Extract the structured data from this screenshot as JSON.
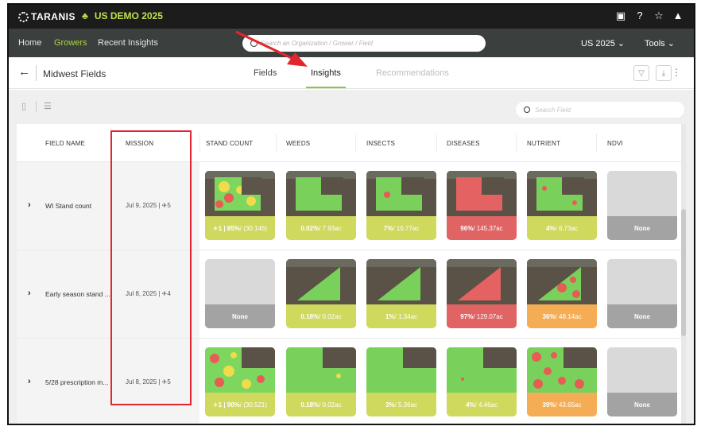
{
  "topbar": {
    "logo": "TARANIS",
    "demo_label": "US DEMO 2025"
  },
  "nav": {
    "home": "Home",
    "growers": "Growers",
    "recent": "Recent Insights",
    "search_placeholder": "Search an Organization / Grower / Field",
    "season": "US 2025",
    "tools": "Tools"
  },
  "subheader": {
    "back": "←",
    "title": "Midwest Fields",
    "tabs": [
      "Fields",
      "Insights",
      "Recommendations"
    ]
  },
  "toolbar": {
    "search_placeholder": "Search Field"
  },
  "table": {
    "headers": [
      "FIELD NAME",
      "MISSION",
      "STAND COUNT",
      "WEEDS",
      "INSECTS",
      "DISEASES",
      "NUTRIENT",
      "NDVI"
    ],
    "rows": [
      {
        "name": "WI Stand count",
        "mission": "Jul 9, 2025 | ✈5",
        "tiles": [
          {
            "strong": "✈1 | 85%",
            "rest": " / (30.146)",
            "color": "#cfd95e"
          },
          {
            "strong": "0.02%",
            "rest": " / 7.93ac",
            "color": "#cfd95e"
          },
          {
            "strong": "7%",
            "rest": " / 10.77ac",
            "color": "#cfd95e"
          },
          {
            "strong": "96%",
            "rest": " / 145.37ac",
            "color": "#e16464"
          },
          {
            "strong": "4%",
            "rest": " / 6.73ac",
            "color": "#cfd95e"
          },
          {
            "strong": "None",
            "rest": "",
            "color": "#a3a3a3"
          }
        ]
      },
      {
        "name": "Early season stand ...",
        "mission": "Jul 8, 2025 | ✈4",
        "tiles": [
          {
            "strong": "None",
            "rest": "",
            "color": "#a3a3a3"
          },
          {
            "strong": "0.18%",
            "rest": " / 0.02ac",
            "color": "#cfd95e"
          },
          {
            "strong": "1%",
            "rest": " / 1.34ac",
            "color": "#cfd95e"
          },
          {
            "strong": "97%",
            "rest": " / 129.07ac",
            "color": "#e16464"
          },
          {
            "strong": "36%",
            "rest": " / 48.14ac",
            "color": "#f5ad55"
          },
          {
            "strong": "None",
            "rest": "",
            "color": "#a3a3a3"
          }
        ]
      },
      {
        "name": "5/28 prescription m...",
        "mission": "Jul 8, 2025 | ✈5",
        "tiles": [
          {
            "strong": "✈1 | 90%",
            "rest": " / (30.521)",
            "color": "#cfd95e"
          },
          {
            "strong": "0.18%",
            "rest": " / 0.02ac",
            "color": "#cfd95e"
          },
          {
            "strong": "3%",
            "rest": " / 5.36ac",
            "color": "#cfd95e"
          },
          {
            "strong": "4%",
            "rest": " / 4.46ac",
            "color": "#cfd95e"
          },
          {
            "strong": "39%",
            "rest": " / 43.65ac",
            "color": "#f5ad55"
          },
          {
            "strong": "None",
            "rest": "",
            "color": "#a3a3a3"
          }
        ]
      }
    ]
  },
  "colors": {
    "accent": "#8cc63f",
    "annotation": "#e3262e",
    "topbar": "#1c1c1c",
    "navbar": "#3b3f3e"
  }
}
